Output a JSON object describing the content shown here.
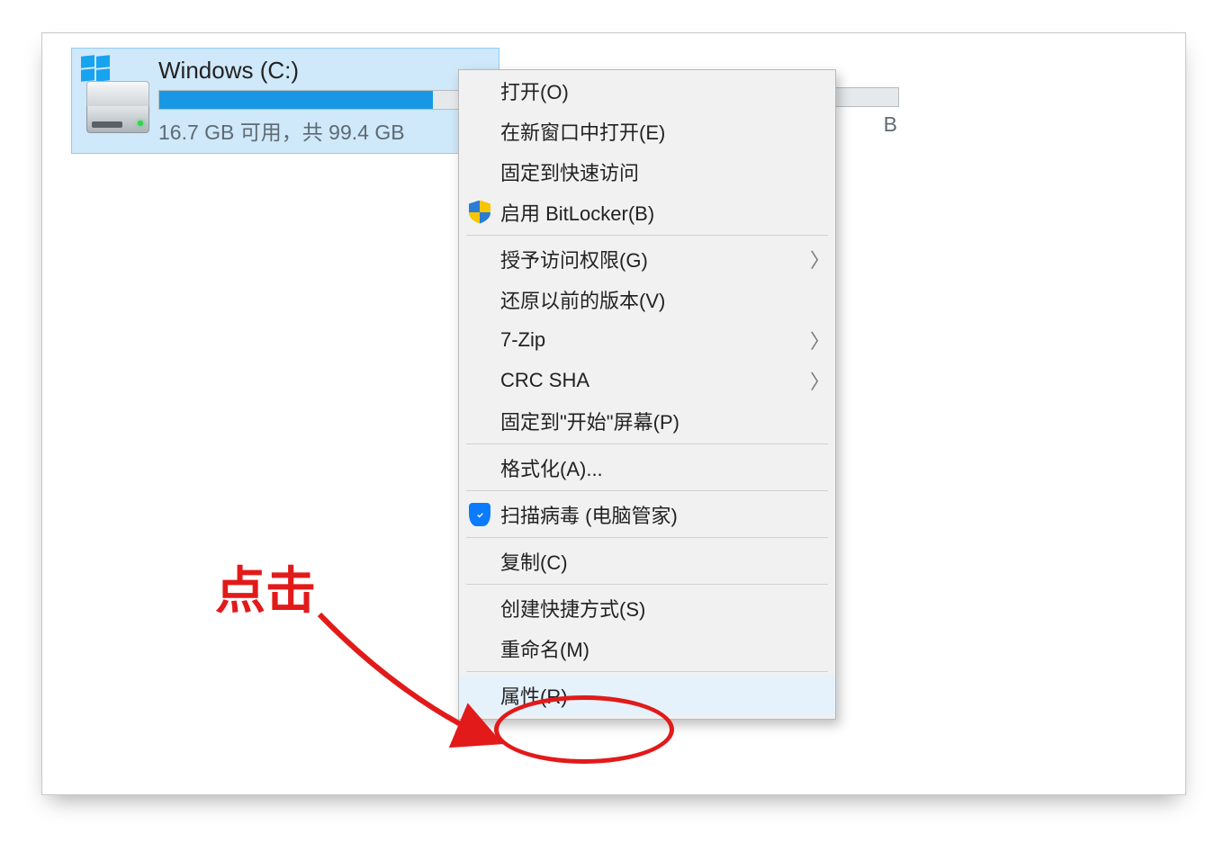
{
  "drive_c": {
    "name": "Windows (C:)",
    "stat": "16.7 GB 可用，共 99.4 GB",
    "used_pct": 83
  },
  "drive_d_hidden": {
    "stat_suffix": "B"
  },
  "context_menu": {
    "items": [
      {
        "label": "打开(O)"
      },
      {
        "label": "在新窗口中打开(E)"
      },
      {
        "label": "固定到快速访问"
      },
      {
        "label": "启用 BitLocker(B)",
        "icon": "shield"
      },
      {
        "sep": true
      },
      {
        "label": "授予访问权限(G)",
        "submenu": true
      },
      {
        "label": "还原以前的版本(V)"
      },
      {
        "label": "7-Zip",
        "submenu": true
      },
      {
        "label": "CRC SHA",
        "submenu": true
      },
      {
        "label": "固定到\"开始\"屏幕(P)"
      },
      {
        "sep": true
      },
      {
        "label": "格式化(A)..."
      },
      {
        "sep": true
      },
      {
        "label": "扫描病毒 (电脑管家)",
        "icon": "qq"
      },
      {
        "sep": true
      },
      {
        "label": "复制(C)"
      },
      {
        "sep": true
      },
      {
        "label": "创建快捷方式(S)"
      },
      {
        "label": "重命名(M)"
      },
      {
        "sep": true
      },
      {
        "label": "属性(R)",
        "highlight": true
      }
    ]
  },
  "annotation": {
    "text": "点击"
  }
}
